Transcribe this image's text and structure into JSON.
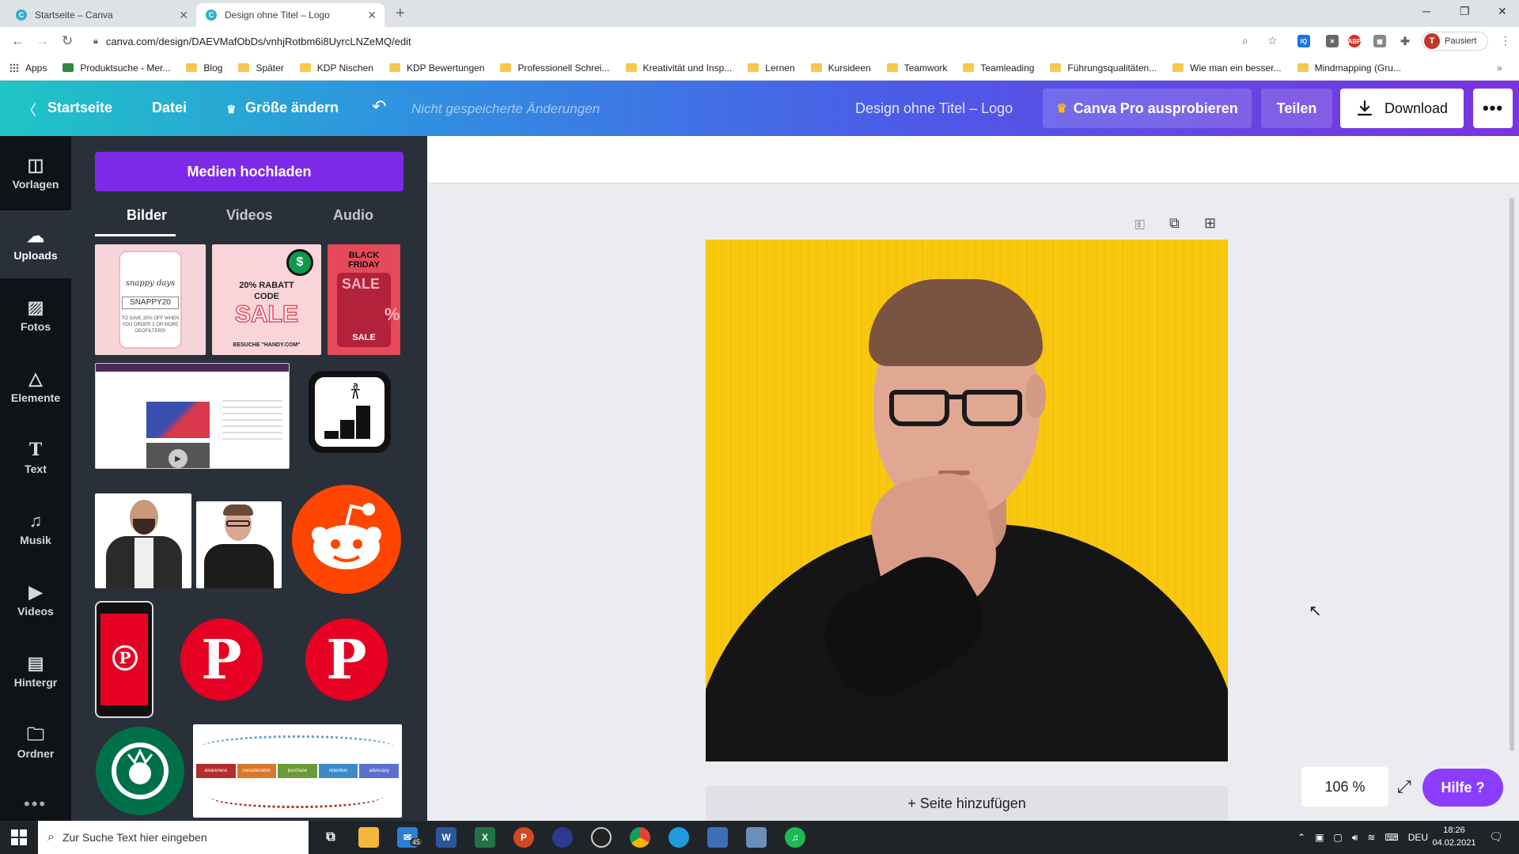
{
  "browser": {
    "tabs": [
      {
        "title": "Startseite – Canva",
        "active": false
      },
      {
        "title": "Design ohne Titel – Logo",
        "active": true
      }
    ],
    "url": "canva.com/design/DAEVMafObDs/vnhjRotbm6i8UyrcLNZeMQ/edit",
    "profile_initial": "T",
    "profile_label": "Pausiert",
    "bookmarks": [
      "Apps",
      "Produktsuche - Mer...",
      "Blog",
      "Später",
      "KDP Nischen",
      "KDP Bewertungen",
      "Professionell Schrei...",
      "Kreativität und Insp...",
      "Lernen",
      "Kursideen",
      "Teamwork",
      "Teamleading",
      "Führungsqualitäten...",
      "Wie man ein besser...",
      "Mindmapping (Gru..."
    ]
  },
  "header": {
    "home": "Startseite",
    "file": "Datei",
    "resize": "Größe ändern",
    "unsaved": "Nicht gespeicherte Änderungen",
    "design_title": "Design ohne Titel – Logo",
    "pro": "Canva Pro ausprobieren",
    "share": "Teilen",
    "download": "Download"
  },
  "rail": [
    {
      "label": "Vorlagen",
      "icon": "templates-icon",
      "active": false
    },
    {
      "label": "Uploads",
      "icon": "cloud-upload-icon",
      "active": true
    },
    {
      "label": "Fotos",
      "icon": "photo-icon",
      "active": false
    },
    {
      "label": "Elemente",
      "icon": "shapes-icon",
      "active": false
    },
    {
      "label": "Text",
      "icon": "text-icon",
      "active": false
    },
    {
      "label": "Musik",
      "icon": "music-icon",
      "active": false
    },
    {
      "label": "Videos",
      "icon": "video-icon",
      "active": false
    },
    {
      "label": "Hintergr",
      "icon": "background-icon",
      "active": false
    },
    {
      "label": "Ordner",
      "icon": "folder-icon",
      "active": false
    }
  ],
  "panel": {
    "upload_button": "Medien hochladen",
    "tabs": [
      "Bilder",
      "Videos",
      "Audio"
    ],
    "active_tab": "Bilder",
    "thumbs": {
      "snappy_title": "snappy days",
      "snappy_code": "SNAPPY20",
      "snappy_text": "TO SAVE 20% OFF WHEN YOU ORDER 2 OR MORE GEOFILTERS!",
      "rabatt_line1": "20% RABATT",
      "rabatt_line2": "CODE",
      "rabatt_sale": "SALE",
      "rabatt_footer": "BESUCHE \"HANDY.COM\"",
      "bf_line1": "BLACK",
      "bf_line2": "FRIDAY",
      "bf_sale": "SALE",
      "bf_percent": "%",
      "bf_sale2": "SALE",
      "journey_steps": [
        "awareness",
        "consideration",
        "purchase",
        "retention",
        "advocacy"
      ]
    }
  },
  "canvas": {
    "add_page": "+ Seite hinzufügen",
    "zoom": "106 %",
    "help": "Hilfe ?"
  },
  "taskbar": {
    "search_placeholder": "Zur Suche Text hier eingeben",
    "mail_badge": "45",
    "language": "DEU",
    "time": "18:26",
    "date": "04.02.2021"
  },
  "colors": {
    "accent_purple": "#7d2ae8",
    "design_background": "#f9c80e",
    "pinterest_red": "#e60023",
    "reddit_orange": "#ff4500",
    "starbucks_green": "#00704a"
  }
}
